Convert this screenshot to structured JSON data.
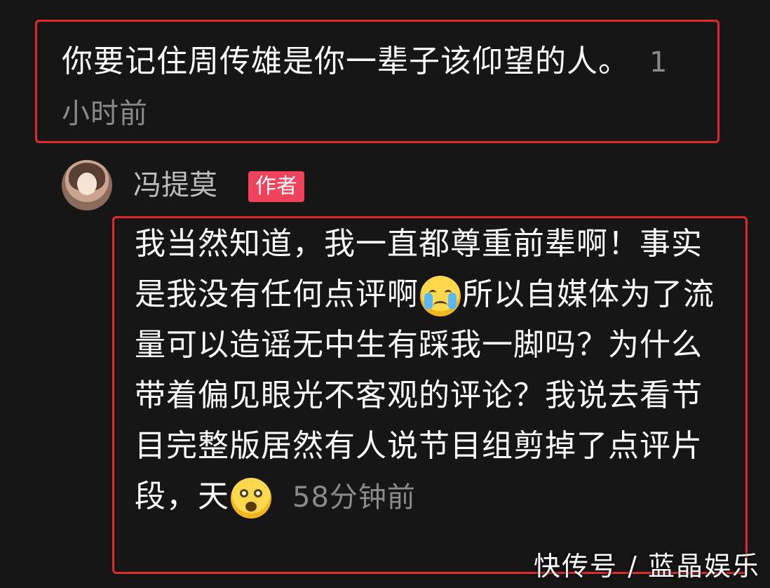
{
  "top_comment": {
    "text": "你要记住周传雄是你一辈子该仰望的人。",
    "time": "1小时前"
  },
  "reply": {
    "username": "冯提莫",
    "badge": "作者",
    "text_part1": "我当然知道，我一直都尊重前辈啊！事实是我没有任何点评啊",
    "emoji1": "crying-face-emoji",
    "text_part2": "所以自媒体为了流量可以造谣无中生有踩我一脚吗？为什么带着偏见眼光不客观的评论？我说去看节目完整版居然有人说节目组剪掉了点评片段，天",
    "emoji2": "astonished-face-emoji",
    "time": "58分钟前"
  },
  "watermark": "快传号 / 蓝晶娱乐",
  "colors": {
    "highlight": "#e02a2a",
    "badge": "#f0425c",
    "background": "#161616"
  }
}
